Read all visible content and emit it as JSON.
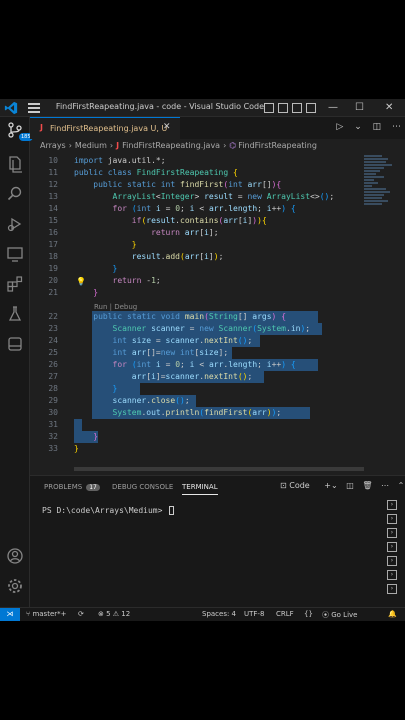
{
  "window": {
    "title": "FindFirstReapeating.java - code - Visual Studio Code",
    "controls": {
      "minimize": "—",
      "maximize": "☐",
      "close": "✕"
    }
  },
  "activity_bar": {
    "badge": "185"
  },
  "tab": {
    "icon_letter": "J",
    "label": "FindFirstReapeating.java  U, U",
    "close": "✕"
  },
  "breadcrumb": {
    "folder1": "Arrays",
    "folder2": "Medium",
    "file": "FindFirstReapeating.java",
    "symbol": "FindFirstReapeating"
  },
  "editor": {
    "codelens": "Run | Debug",
    "lines": [
      {
        "n": "10",
        "html": "<span class=\"kw\">import</span> java.util.*;"
      },
      {
        "n": "11",
        "html": "<span class=\"kw\">public</span> <span class=\"kw\">class</span> <span class=\"ty\">FindFirstReapeating</span> <span class=\"br\">{</span>"
      },
      {
        "n": "12",
        "html": "    <span class=\"kw\">public</span> <span class=\"kw\">static</span> <span class=\"kw\">int</span> <span class=\"fn\">findFirst</span><span class=\"br2\">(</span><span class=\"kw\">int</span> <span class=\"var\">arr</span>[]<span class=\"br2\">)</span><span class=\"br2\">{</span>"
      },
      {
        "n": "13",
        "html": "        <span class=\"ty\">ArrayList</span>&lt;<span class=\"ty\">Integer</span>&gt; <span class=\"var\">result</span> = <span class=\"kw\">new</span> <span class=\"ty\">ArrayList</span>&lt;&gt;<span class=\"br3\">()</span>;"
      },
      {
        "n": "14",
        "html": "        <span class=\"ctl\">for</span> <span class=\"br3\">(</span><span class=\"kw\">int</span> <span class=\"var\">i</span> = <span class=\"num\">0</span>; <span class=\"var\">i</span> &lt; <span class=\"var\">arr</span>.<span class=\"var\">length</span>; <span class=\"var\">i</span>++<span class=\"br3\">)</span> <span class=\"br3\">{</span>"
      },
      {
        "n": "15",
        "html": "            <span class=\"ctl\">if</span><span class=\"br\">(</span><span class=\"var\">result</span>.<span class=\"fn\">contains</span><span class=\"br2\">(</span><span class=\"var\">arr</span>[<span class=\"var\">i</span>]<span class=\"br2\">)</span><span class=\"br\">)</span><span class=\"br\">{</span>"
      },
      {
        "n": "16",
        "html": "                <span class=\"ctl\">return</span> <span class=\"var\">arr</span>[<span class=\"var\">i</span>];"
      },
      {
        "n": "17",
        "html": "            <span class=\"br\">}</span>"
      },
      {
        "n": "18",
        "html": "            <span class=\"var\">result</span>.<span class=\"fn\">add</span><span class=\"br\">(</span><span class=\"var\">arr</span>[<span class=\"var\">i</span>]<span class=\"br\">)</span>;"
      },
      {
        "n": "19",
        "html": "        <span class=\"br3\">}</span>"
      },
      {
        "n": "20",
        "html": "        <span class=\"ctl\">return</span> -<span class=\"num\">1</span>;"
      },
      {
        "n": "21",
        "html": "    <span class=\"br2\">}</span>"
      },
      {
        "n": "22",
        "html": "    <span class=\"kw\">public</span> <span class=\"kw\">static</span> <span class=\"kw\">void</span> <span class=\"fn\">main</span><span class=\"br2\">(</span><span class=\"ty\">String</span>[] <span class=\"var\">args</span><span class=\"br2\">)</span> <span class=\"br2\">{</span>"
      },
      {
        "n": "23",
        "html": "        <span class=\"ty\">Scanner</span> <span class=\"var\">scanner</span> = <span class=\"kw\">new</span> <span class=\"ty\">Scanner</span><span class=\"br3\">(</span><span class=\"ty\">System</span>.<span class=\"var\">in</span><span class=\"br3\">)</span>;"
      },
      {
        "n": "24",
        "html": "        <span class=\"kw\">int</span> <span class=\"var\">size</span> = <span class=\"var\">scanner</span>.<span class=\"fn\">nextInt</span><span class=\"br3\">()</span>;"
      },
      {
        "n": "25",
        "html": "        <span class=\"kw\">int</span> <span class=\"var\">arr</span>[]=<span class=\"kw\">new</span> <span class=\"kw\">int</span>[<span class=\"var\">size</span>];"
      },
      {
        "n": "26",
        "html": "        <span class=\"ctl\">for</span> <span class=\"br3\">(</span><span class=\"kw\">int</span> <span class=\"var\">i</span> = <span class=\"num\">0</span>; <span class=\"var\">i</span> &lt; <span class=\"var\">arr</span>.<span class=\"var\">length</span>; <span class=\"var\">i</span>++<span class=\"br3\">)</span> <span class=\"br3\">{</span>"
      },
      {
        "n": "27",
        "html": "            <span class=\"var\">arr</span>[<span class=\"var\">i</span>]=<span class=\"var\">scanner</span>.<span class=\"fn\">nextInt</span><span class=\"br\">()</span>;"
      },
      {
        "n": "28",
        "html": "        <span class=\"br3\">}</span>"
      },
      {
        "n": "29",
        "html": "        <span class=\"var\">scanner</span>.<span class=\"fn\">close</span><span class=\"br3\">()</span>;"
      },
      {
        "n": "30",
        "html": "        <span class=\"ty\">System</span>.<span class=\"var\">out</span>.<span class=\"fn\">println</span><span class=\"br3\">(</span><span class=\"fn\">findFirst</span><span class=\"br\">(</span><span class=\"var\">arr</span><span class=\"br\">)</span><span class=\"br3\">)</span>;"
      },
      {
        "n": "31",
        "html": ""
      },
      {
        "n": "32",
        "html": "    <span class=\"br2\">}</span>"
      },
      {
        "n": "33",
        "html": "<span class=\"br\">}</span>"
      }
    ]
  },
  "panel": {
    "problems_label": "PROBLEMS",
    "problems_count": "17",
    "debug_label": "DEBUG CONSOLE",
    "terminal_label": "TERMINAL",
    "shell_label": "Code",
    "prompt": "PS D:\\code\\Arrays\\Medium>"
  },
  "status": {
    "branch": "master*+",
    "errors": "5",
    "warnings": "12",
    "spaces": "Spaces: 4",
    "encoding": "UTF-8",
    "eol": "CRLF",
    "language": "{}",
    "golive": "Go Live"
  },
  "colors": {
    "accent": "#0078d4",
    "editor_bg": "#1f1f1f",
    "selection": "#264f78"
  }
}
